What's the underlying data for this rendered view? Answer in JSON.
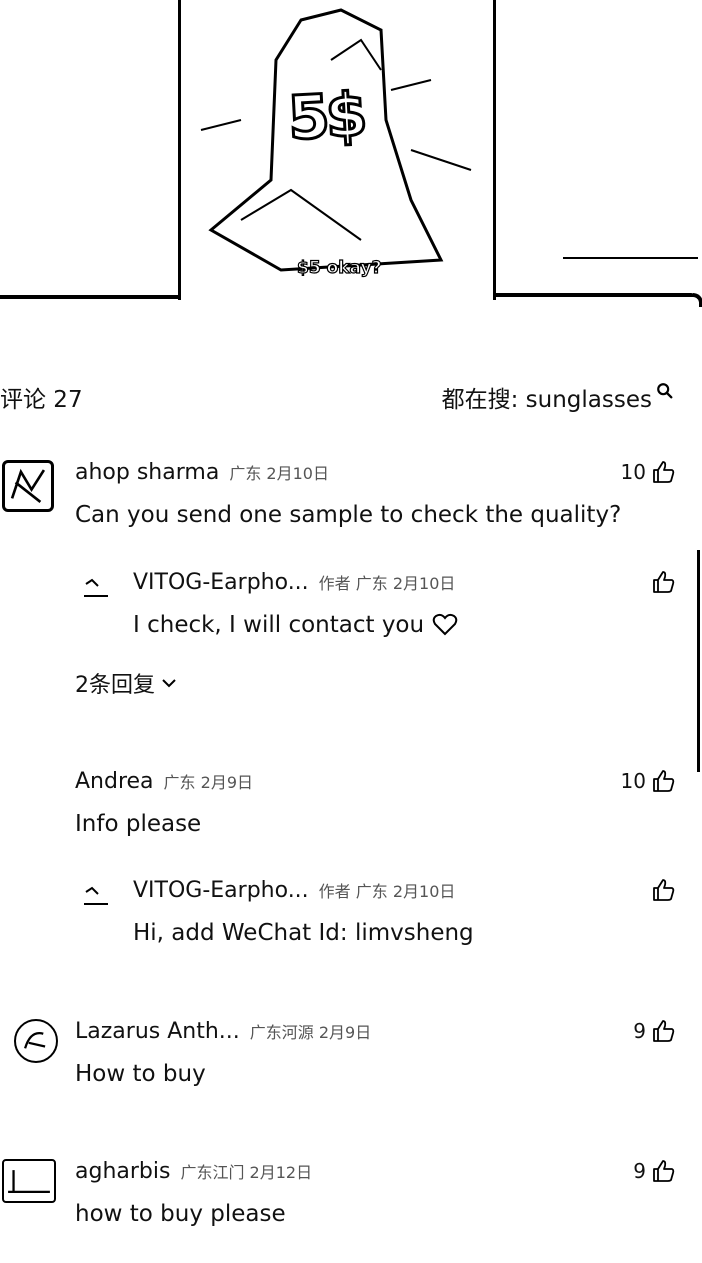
{
  "video": {
    "price_badge": "5$",
    "caption": "$5 okay?"
  },
  "header": {
    "comments_label": "评论 27",
    "search_hint": "都在搜: sunglasses",
    "search_icon": "search-icon"
  },
  "comments": [
    {
      "author": "ahop sharma",
      "meta": "广东 2月10日",
      "text": "Can you send one sample to check the quality?",
      "likes": "10",
      "reply": {
        "author": "VITOG-Earpho...",
        "meta": "作者 广东 2月10日",
        "text": "I check, I will contact you",
        "icon": "heart-icon"
      },
      "more_replies": "2条回复"
    },
    {
      "author": "Andrea",
      "meta": "广东 2月9日",
      "text": "Info please",
      "likes": "10",
      "reply": {
        "author": "VITOG-Earpho...",
        "meta": "作者 广东 2月10日",
        "text": "Hi, add WeChat Id: limvsheng"
      }
    },
    {
      "author": "Lazarus Anth...",
      "meta": "广东河源 2月9日",
      "text": "How to buy",
      "likes": "9"
    },
    {
      "author": "agharbis",
      "meta": "广东江门 2月12日",
      "text": "how to buy please",
      "likes": "9"
    }
  ],
  "colors": {
    "text": "#111111",
    "meta": "#555555",
    "background": "#ffffff"
  }
}
